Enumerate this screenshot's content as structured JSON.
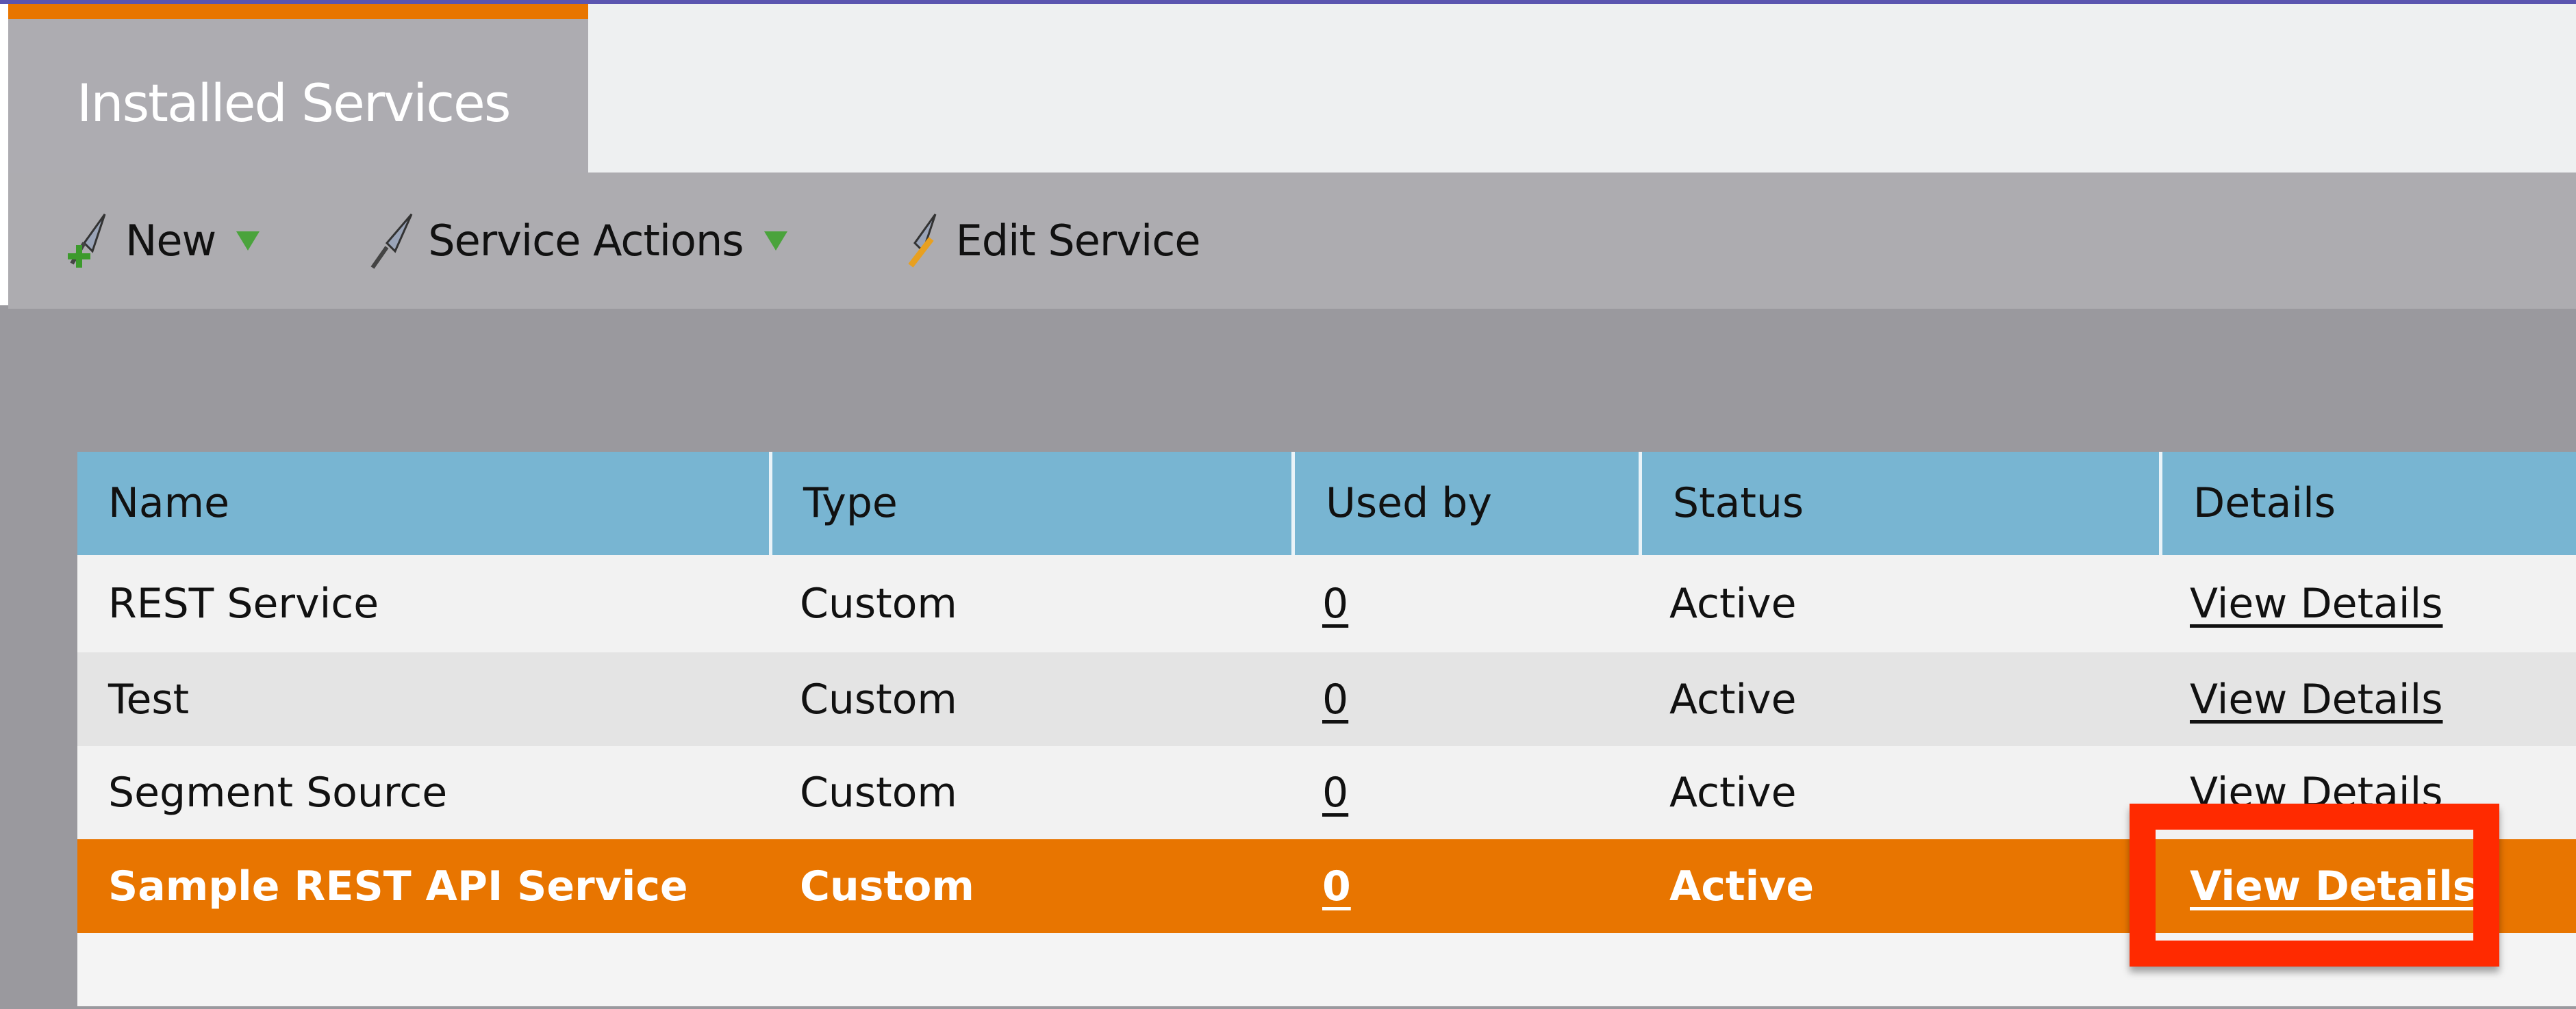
{
  "tab": {
    "label": "Installed Services",
    "accent_color": "#e87500"
  },
  "toolbar": {
    "items": [
      {
        "label": "New",
        "icon": "rocket-plus-icon",
        "dropdown": true
      },
      {
        "label": "Service Actions",
        "icon": "rocket-icon",
        "dropdown": true
      },
      {
        "label": "Edit Service",
        "icon": "rocket-pencil-icon",
        "dropdown": false
      }
    ]
  },
  "table": {
    "columns": [
      "Name",
      "Type",
      "Used by",
      "Status",
      "Details"
    ],
    "rows": [
      {
        "name": "REST Service",
        "type": "Custom",
        "used_by": "0",
        "status": "Active",
        "details": "View Details"
      },
      {
        "name": "Test",
        "type": "Custom",
        "used_by": "0",
        "status": "Active",
        "details": "View Details"
      },
      {
        "name": "Segment Source",
        "type": "Custom",
        "used_by": "0",
        "status": "Active",
        "details": "View Details"
      },
      {
        "name": "Sample REST API Service",
        "type": "Custom",
        "used_by": "0",
        "status": "Active",
        "details": "View Details",
        "selected": true
      }
    ],
    "header_color": "#78b5d2",
    "selected_color": "#e87500"
  },
  "highlight": {
    "color": "#ff2a00"
  }
}
